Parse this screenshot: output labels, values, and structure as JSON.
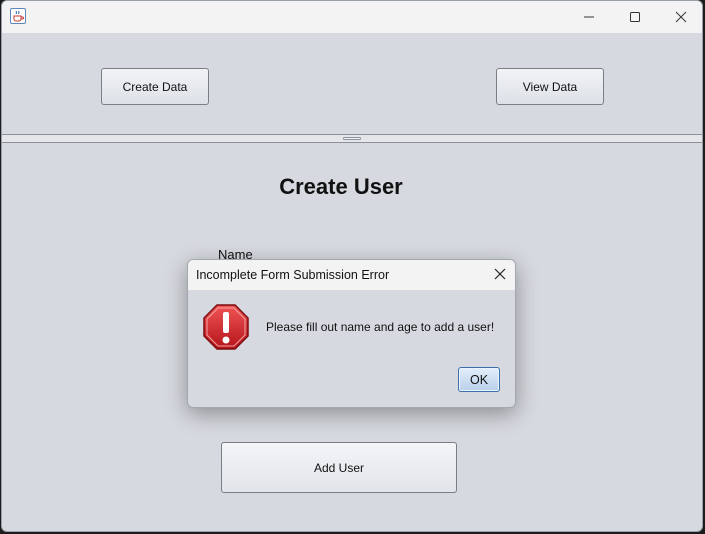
{
  "window": {
    "icon": "java-cup-icon",
    "controls": {
      "minimize": "minimize-icon",
      "maximize": "maximize-icon",
      "close": "close-icon"
    }
  },
  "top_panel": {
    "create_data_label": "Create Data",
    "view_data_label": "View Data"
  },
  "form": {
    "title": "Create User",
    "name_label": "Name",
    "add_user_label": "Add User"
  },
  "dialog": {
    "title": "Incomplete Form Submission Error",
    "message": "Please fill out name and age to add a user!",
    "ok_label": "OK",
    "icon": "error-stop-icon",
    "accent_color": "#cc1f1f"
  }
}
